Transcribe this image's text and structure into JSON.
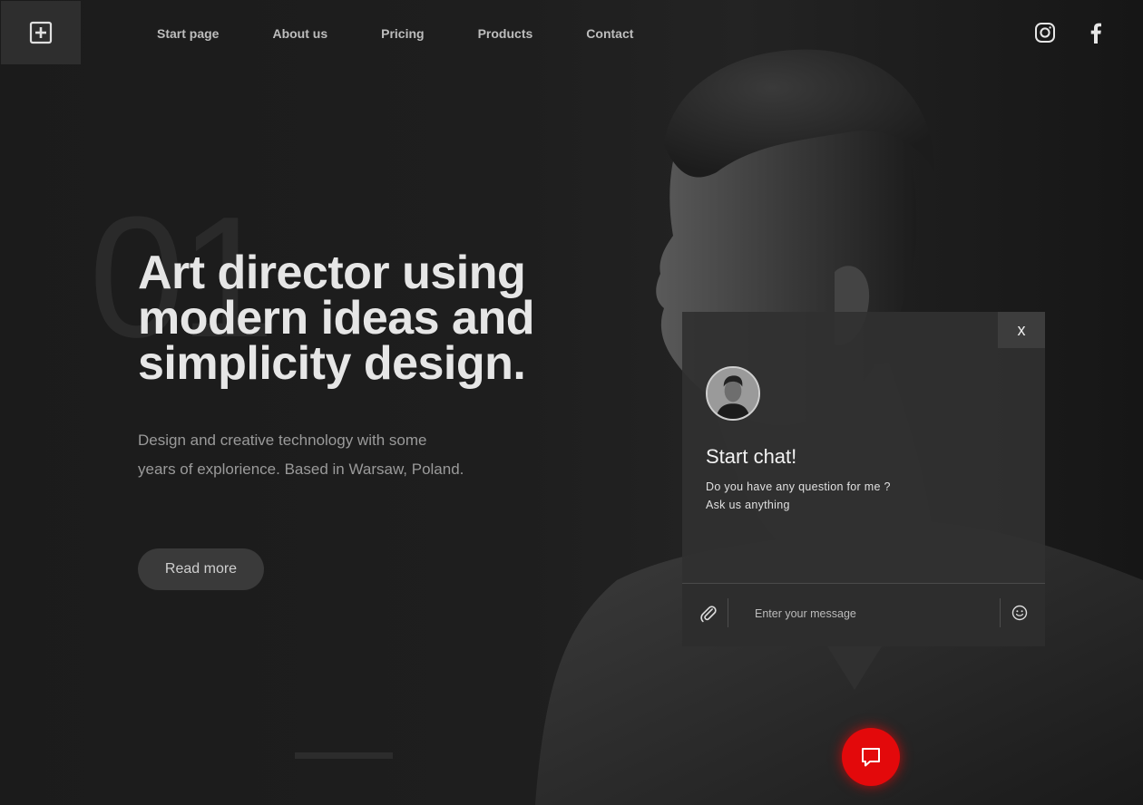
{
  "nav": {
    "items": [
      {
        "label": "Start page"
      },
      {
        "label": "About us"
      },
      {
        "label": "Pricing"
      },
      {
        "label": "Products"
      },
      {
        "label": "Contact"
      }
    ]
  },
  "social": {
    "icons": [
      "instagram-icon",
      "facebook-icon"
    ]
  },
  "hero": {
    "number": "01",
    "headline_lines": [
      "Art director using",
      "modern ideas and",
      "simplicity design."
    ],
    "description": "Design and creative technology with some years of explorience. Based in Warsaw, Poland.",
    "read_more_label": "Read more"
  },
  "chat": {
    "close_label": "x",
    "title": "Start chat!",
    "subtitle_lines": [
      "Do you have any question for me ?",
      "Ask us anything"
    ],
    "input_placeholder": "Enter your message"
  },
  "colors": {
    "accent": "#e3090b",
    "background": "#1a1a1a",
    "panel": "#303030"
  }
}
